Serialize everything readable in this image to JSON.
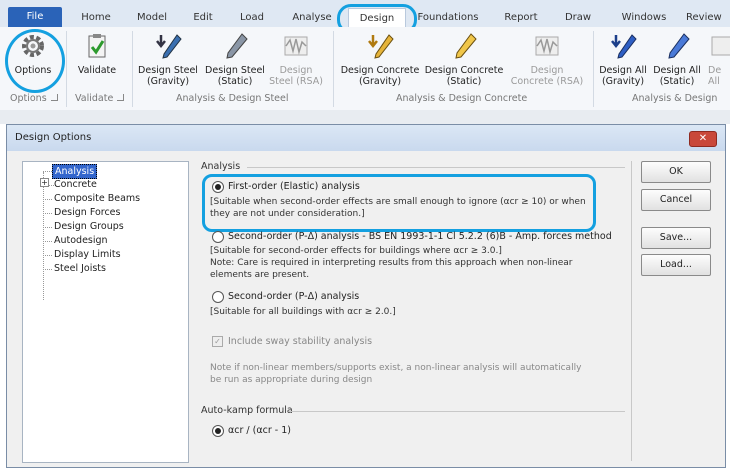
{
  "ribbon": {
    "tabs": [
      "File",
      "Home",
      "Model",
      "Edit",
      "Load",
      "Analyse",
      "Design",
      "Foundations",
      "Report",
      "Draw",
      "Windows",
      "Review"
    ],
    "active_tab": "Design",
    "buttons": {
      "options": "Options",
      "validate": "Validate",
      "design_steel_gravity": [
        "Design Steel",
        "(Gravity)"
      ],
      "design_steel_static": [
        "Design Steel",
        "(Static)"
      ],
      "design_steel_rsa": [
        "Design",
        "Steel (RSA)"
      ],
      "design_concrete_gravity": [
        "Design Concrete",
        "(Gravity)"
      ],
      "design_concrete_static": [
        "Design Concrete",
        "(Static)"
      ],
      "design_concrete_rsa": [
        "Design",
        "Concrete (RSA)"
      ],
      "design_all_gravity": [
        "Design All",
        "(Gravity)"
      ],
      "design_all_static": [
        "Design All",
        "(Static)"
      ],
      "design_all_partial": [
        "De",
        "All"
      ]
    },
    "groups": {
      "options": "Options",
      "validate": "Validate",
      "steel": "Analysis & Design Steel",
      "concrete": "Analysis & Design Concrete",
      "all": "Analysis & Design"
    },
    "colors": {
      "file_tab": "#2a63b8",
      "highlight": "#14a0e0"
    }
  },
  "dialog": {
    "title": "Design Options",
    "close_glyph": "✕",
    "tree": [
      "Analysis",
      "Concrete",
      "Composite Beams",
      "Design Forces",
      "Design Groups",
      "Autodesign",
      "Display Limits",
      "Steel Joists"
    ],
    "tree_expander": "+",
    "section_analysis": "Analysis",
    "option1": {
      "label": "First-order (Elastic) analysis",
      "note_line1": "[Suitable when second-order effects are small enough to ignore (αcr ≥ 10) or when",
      "note_line2": "they are not under consideration.]"
    },
    "option2": {
      "label": "Second-order (P-Δ) analysis - BS EN 1993-1-1 Cl 5.2.2 (6)B - Amp. forces method",
      "note_line1": "[Suitable for second-order effects for buildings where αcr ≥ 3.0.]",
      "note_line2": "Note: Care is required in interpreting results from this approach when non-linear",
      "note_line3": "elements are present."
    },
    "option3": {
      "label": "Second-order (P-Δ) analysis",
      "note_line1": "[Suitable for all buildings with αcr ≥ 2.0.]"
    },
    "sway_check": "Include sway stability analysis",
    "sway_check_mark": "✓",
    "nonlinear_note1": "Note if non-linear members/supports exist, a non-linear analysis will automatically",
    "nonlinear_note2": "be run as appropriate during design",
    "section_kamp": "Auto-kamp formula",
    "kamp_option": "αcr / (αcr - 1)",
    "buttons": {
      "ok": "OK",
      "cancel": "Cancel",
      "save": "Save...",
      "load": "Load..."
    }
  }
}
